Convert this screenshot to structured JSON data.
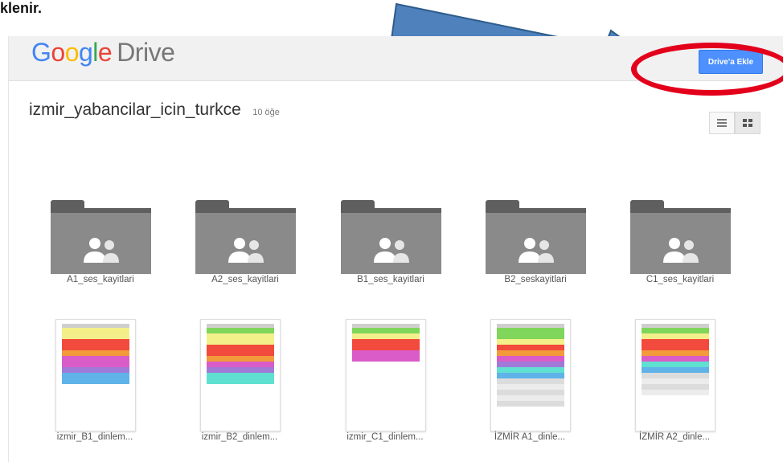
{
  "caption": "klenir.",
  "app": {
    "logo_letters": [
      "G",
      "o",
      "o",
      "g",
      "l",
      "e"
    ],
    "product": "Drive"
  },
  "header": {
    "add_button": "Drive'a Ekle"
  },
  "folder": {
    "title": "izmir_yabancilar_icin_turkce",
    "count": "10 öğe"
  },
  "view_toggle": {
    "list_icon": "list-view-icon",
    "grid_icon": "grid-view-icon",
    "active": "grid"
  },
  "folders": [
    {
      "label": "A1_ses_kayitlari"
    },
    {
      "label": "A2_ses_kayitlari"
    },
    {
      "label": "B1_ses_kayitlari"
    },
    {
      "label": "B2_seskayitlari"
    },
    {
      "label": "C1_ses_kayitlari"
    }
  ],
  "files": [
    {
      "label": "izmir_B1_dinlem..."
    },
    {
      "label": "izmir_B2_dinlem..."
    },
    {
      "label": "izmir_C1_dinlem..."
    },
    {
      "label": "İZMİR A1_dinle..."
    },
    {
      "label": "İZMİR A2_dinle..."
    }
  ],
  "colors": {
    "accent_button": "#4d90fe",
    "highlight_ring": "#e3001b",
    "arrow_fill": "#4f81bd",
    "folder_gray": "#8a8a8a"
  }
}
